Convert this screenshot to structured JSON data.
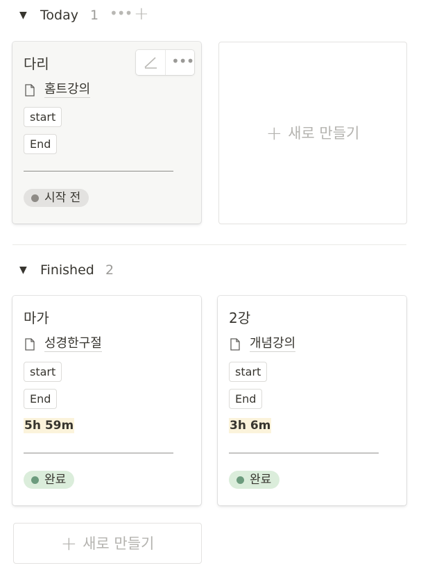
{
  "groups": [
    {
      "title": "Today",
      "count": "1",
      "cards": [
        {
          "title": "다리",
          "relation": "홈트강의",
          "tags": [
            "start",
            "End"
          ],
          "status": "시작 전"
        }
      ],
      "new_label": "새로 만들기"
    },
    {
      "title": "Finished",
      "count": "2",
      "cards": [
        {
          "title": "마가",
          "relation": "성경한구절",
          "tags": [
            "start",
            "End"
          ],
          "duration": "5h 59m",
          "status": "완료"
        },
        {
          "title": "2강",
          "relation": "개념강의",
          "tags": [
            "start",
            "End"
          ],
          "duration": "3h 6m",
          "status": "완료"
        }
      ],
      "new_label": "새로 만들기"
    }
  ],
  "icons": {
    "toggle": "triangle-down-icon",
    "more": "ellipsis-icon",
    "add": "plus-icon",
    "page": "page-icon",
    "edit": "pencil-icon"
  },
  "colors": {
    "not_started_bg": "#e3e2e0",
    "not_started_dot": "#8e8b86",
    "done_bg": "#dbeddb",
    "done_dot": "#6c9b7d",
    "duration_highlight": "#fbf3db"
  }
}
